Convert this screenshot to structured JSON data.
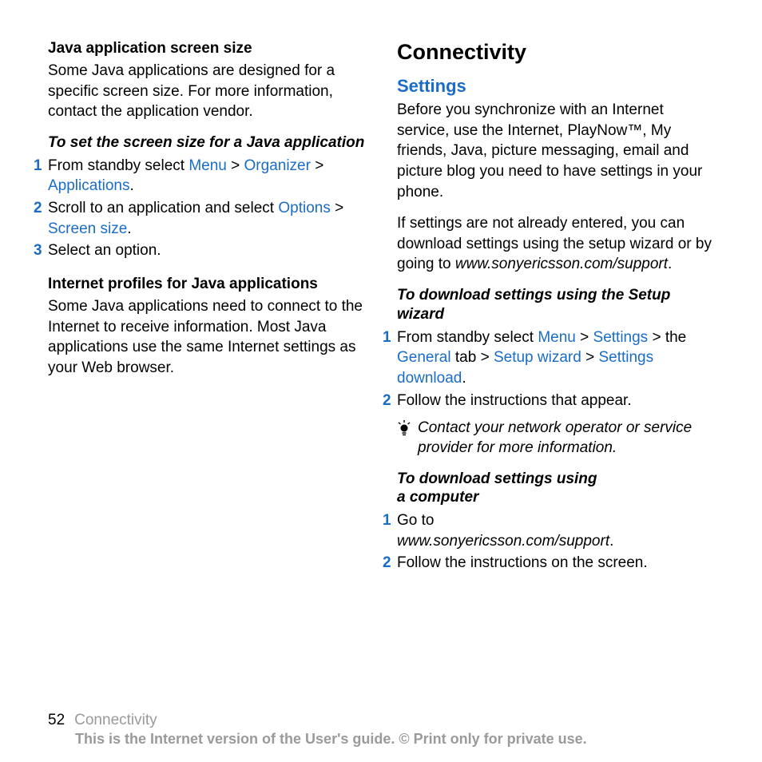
{
  "left": {
    "sec1_title": "Java application screen size",
    "sec1_body": "Some Java applications are designed for a specific screen size. For more information, contact the application vendor.",
    "sub1_title": "To set the screen size for a Java application",
    "step1_a": "From standby select ",
    "menu": "Menu",
    "gt": " > ",
    "organizer": "Organizer",
    "applications": "Applications",
    "period": ".",
    "step2_a": "Scroll to an application and select ",
    "options": "Options",
    "screen_size": "Screen size",
    "step3": "Select an option.",
    "sec2_title": "Internet profiles for Java applications",
    "sec2_body": "Some Java applications need to connect to the Internet to receive information. Most Java applications use the same Internet settings as your Web browser."
  },
  "right": {
    "h1": "Connectivity",
    "h2": "Settings",
    "p1": "Before you synchronize with an Internet service, use the Internet, PlayNow™, My friends, Java, picture messaging, email and picture blog you need to have settings in your phone.",
    "p2a": "If settings are not already entered, you can download settings using the setup wizard or by going to ",
    "p2b": "www.sonyericsson.com/support",
    "sub1_title": "To download settings using the Setup wizard",
    "r_step1_a": "From standby select ",
    "menu": "Menu",
    "gt": " > ",
    "settings": "Settings",
    "the_pre": " > the ",
    "general": "General",
    "tab_post": " tab > ",
    "setup_wizard": "Setup wizard",
    "settings_dl": "Settings download",
    "period": ".",
    "r_step2": "Follow the instructions that appear.",
    "tip": "Contact your network operator or service provider for more information.",
    "sub2_line1": "To download settings using",
    "sub2_line2": "a computer",
    "c_step1_a": "Go to ",
    "c_step1_b": "www.sonyericsson.com/support",
    "c_step2": "Follow the instructions on the screen."
  },
  "footer": {
    "page": "52",
    "section": "Connectivity",
    "notice": "This is the Internet version of the User's guide. © Print only for private use."
  }
}
